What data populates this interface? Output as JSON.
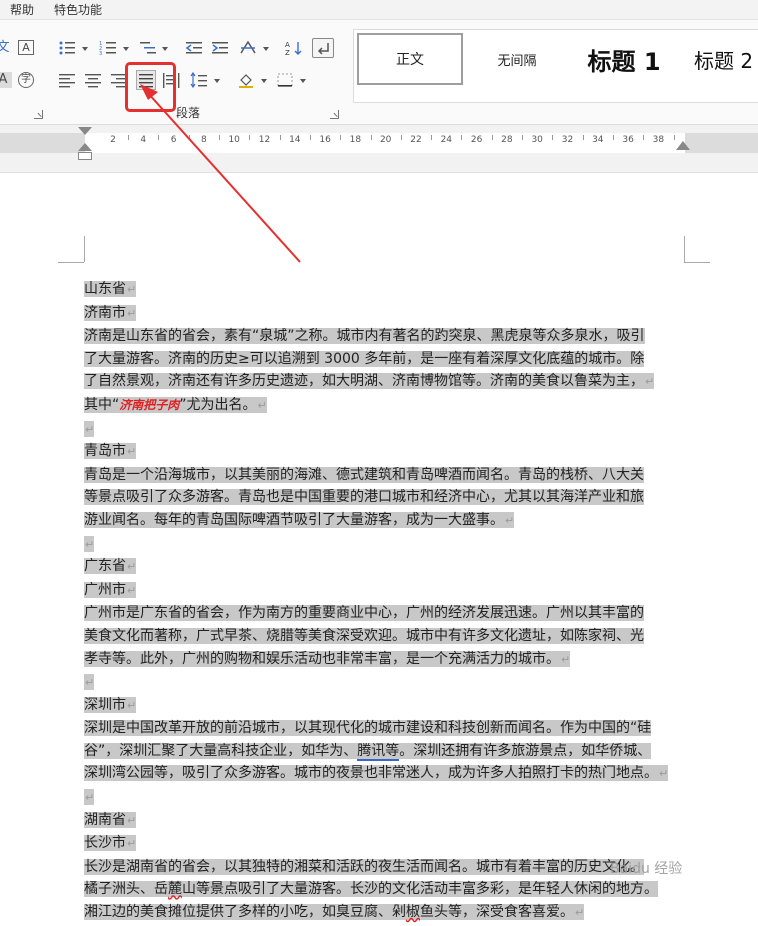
{
  "menu": {
    "items": [
      "帮助",
      "特色功能"
    ]
  },
  "ribbon": {
    "paragraph_group_label": "段落",
    "styles": {
      "normal": "正文",
      "no_spacing": "无间隔",
      "heading1": "标题 1",
      "heading2": "标题 2"
    },
    "highlighted_button": "justify-align-button",
    "highlight_color": "#e53030"
  },
  "ruler": {
    "ticks": [
      "2",
      "4",
      "6",
      "8",
      "10",
      "12",
      "14",
      "16",
      "18",
      "20",
      "22",
      "24",
      "26",
      "28",
      "30",
      "32",
      "34",
      "36",
      "38"
    ]
  },
  "document": {
    "blocks": [
      {
        "type": "line",
        "text": "山东省"
      },
      {
        "type": "line",
        "text": "济南市"
      },
      {
        "type": "para",
        "lines": [
          "济南是山东省的省会，素有“泉城”之称。城市内有著名的趵突泉、黑虎泉等众多泉水，吸引",
          "了大量游客。济南的历史≥可以追溯到 3000 多年前，是一座有着深厚文化底蕴的城市。除",
          "了自然景观，济南还有许多历史遗迹，如大明湖、济南博物馆等。济南的美食以鲁菜为主，"
        ]
      },
      {
        "type": "line",
        "text_before": "其中“",
        "special": "济南把子肉",
        "text_after": "”尤为出名。"
      },
      {
        "type": "empty"
      },
      {
        "type": "line",
        "text": "青岛市"
      },
      {
        "type": "para",
        "lines": [
          "青岛是一个沿海城市，以其美丽的海滩、德式建筑和青岛啤酒而闻名。青岛的栈桥、八大关",
          "等景点吸引了众多游客。青岛也是中国重要的港口城市和经济中心，尤其以其海洋产业和旅",
          "游业闻名。每年的青岛国际啤酒节吸引了大量游客，成为一大盛事。"
        ]
      },
      {
        "type": "empty"
      },
      {
        "type": "line",
        "text": "广东省"
      },
      {
        "type": "line",
        "text": "广州市"
      },
      {
        "type": "para",
        "lines": [
          "广州市是广东省的省会，作为南方的重要商业中心，广州的经济发展迅速。广州以其丰富的",
          "美食文化而著称，广式早茶、烧腊等美食深受欢迎。城市中有许多文化遗址，如陈家祠、光",
          "孝寺等。此外，广州的购物和娱乐活动也非常丰富，是一个充满活力的城市。"
        ]
      },
      {
        "type": "empty"
      },
      {
        "type": "line",
        "text": "深圳市"
      },
      {
        "type": "para_sz",
        "l1": "深圳是中国改革开放的前沿城市，以其现代化的城市建设和科技创新而闻名。作为中国的“硅",
        "l2a": "谷”，深圳汇聚了大量高科技企业，如华为、",
        "l2u": "腾讯等",
        "l2b": "。深圳还拥有许多旅游景点，如华侨城、",
        "l3": "深圳湾公园等，吸引了众多游客。城市的夜景也非常迷人，成为许多人拍照打卡的热门地点。"
      },
      {
        "type": "empty"
      },
      {
        "type": "line",
        "text": "湖南省"
      },
      {
        "type": "line",
        "text": "长沙市"
      },
      {
        "type": "para_cs",
        "l1": "长沙是湖南省的省会，以其独特的湘菜和活跃的夜生活而闻名。城市有着丰富的历史文化。",
        "l2a": "橘子洲头、岳",
        "l2s": "麓",
        "l2b": "山等景点吸引了大量游客。长沙的文化活动丰富多彩，是年轻人休闲的地方。",
        "l3a": "湘江边的美食摊位提供了多样的小吃，如臭豆腐、剁",
        "l3s": "椒",
        "l3b": "鱼头等，深受食客喜爱。"
      },
      {
        "type": "empty"
      }
    ]
  },
  "watermark": "Baidu 经验"
}
